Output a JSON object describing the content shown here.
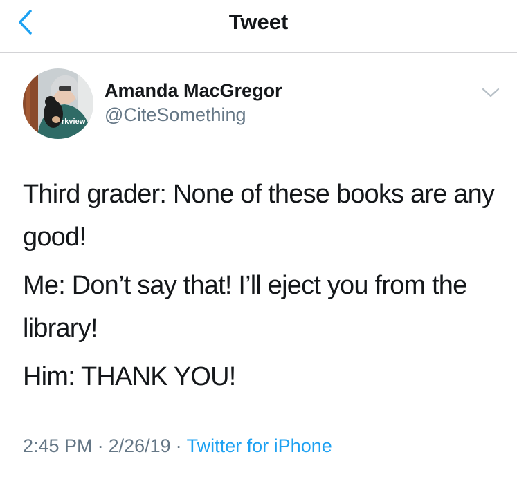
{
  "nav": {
    "title": "Tweet",
    "back_icon": "chevron-left-icon",
    "accent_color": "#1da1f2"
  },
  "author": {
    "name": "Amanda MacGregor",
    "handle": "@CiteSomething",
    "avatar_shirt_text": "rkview",
    "menu_icon": "chevron-down-icon"
  },
  "tweet": {
    "paragraphs": [
      "Third grader: None of these books are any good!",
      "Me: Don’t say that! I’ll eject you from the library!",
      "Him: THANK YOU!"
    ]
  },
  "meta": {
    "time": "2:45 PM",
    "separator": "·",
    "date": "2/26/19",
    "source": "Twitter for iPhone"
  },
  "colors": {
    "text_primary": "#14171a",
    "text_secondary": "#657786",
    "divider": "#d3d3d6",
    "link": "#1da1f2"
  }
}
